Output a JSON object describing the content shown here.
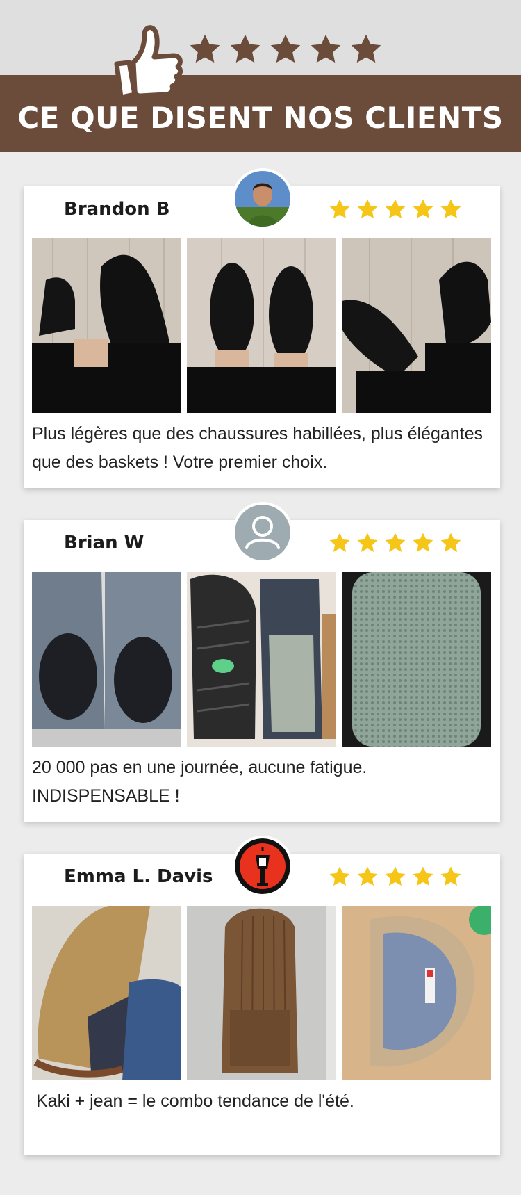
{
  "header": {
    "title": "CE QUE DISENT NOS CLIENTS",
    "star_count": 5,
    "banner_color": "#6b4c3b",
    "star_color": "#6b4c3b",
    "icons": [
      "thumbs-up-icon",
      "star-icon"
    ]
  },
  "reviews": [
    {
      "name": "Brandon B",
      "rating": 5,
      "text": "Plus légères que des chaussures habillées, plus élégantes que des baskets ! Votre premier choix.",
      "avatar": "avatar-photo-man",
      "photos": [
        "black-corduroy-shoes-photo-1",
        "black-corduroy-shoes-photo-2",
        "black-corduroy-shoes-photo-3"
      ]
    },
    {
      "name": "Brian W",
      "rating": 5,
      "text": "20 000 pas en une journée, aucune fatigue. INDISPENSABLE !",
      "avatar": "default-user-icon",
      "photos": [
        "grey-shoes-insole-photo",
        "grey-shoes-sole-photo",
        "mesh-insole-closeup-photo"
      ]
    },
    {
      "name": "Emma L. Davis",
      "rating": 5,
      "text": "Kaki + jean = le combo tendance de l'été.",
      "avatar": "lantern-logo-avatar",
      "photos": [
        "khaki-shoe-with-jeans-photo",
        "brown-corduroy-shoe-photo",
        "khaki-shoe-interior-photo"
      ]
    }
  ],
  "colors": {
    "rating_star": "#f5c518",
    "page_bg": "#ececec",
    "card_bg": "#ffffff"
  }
}
